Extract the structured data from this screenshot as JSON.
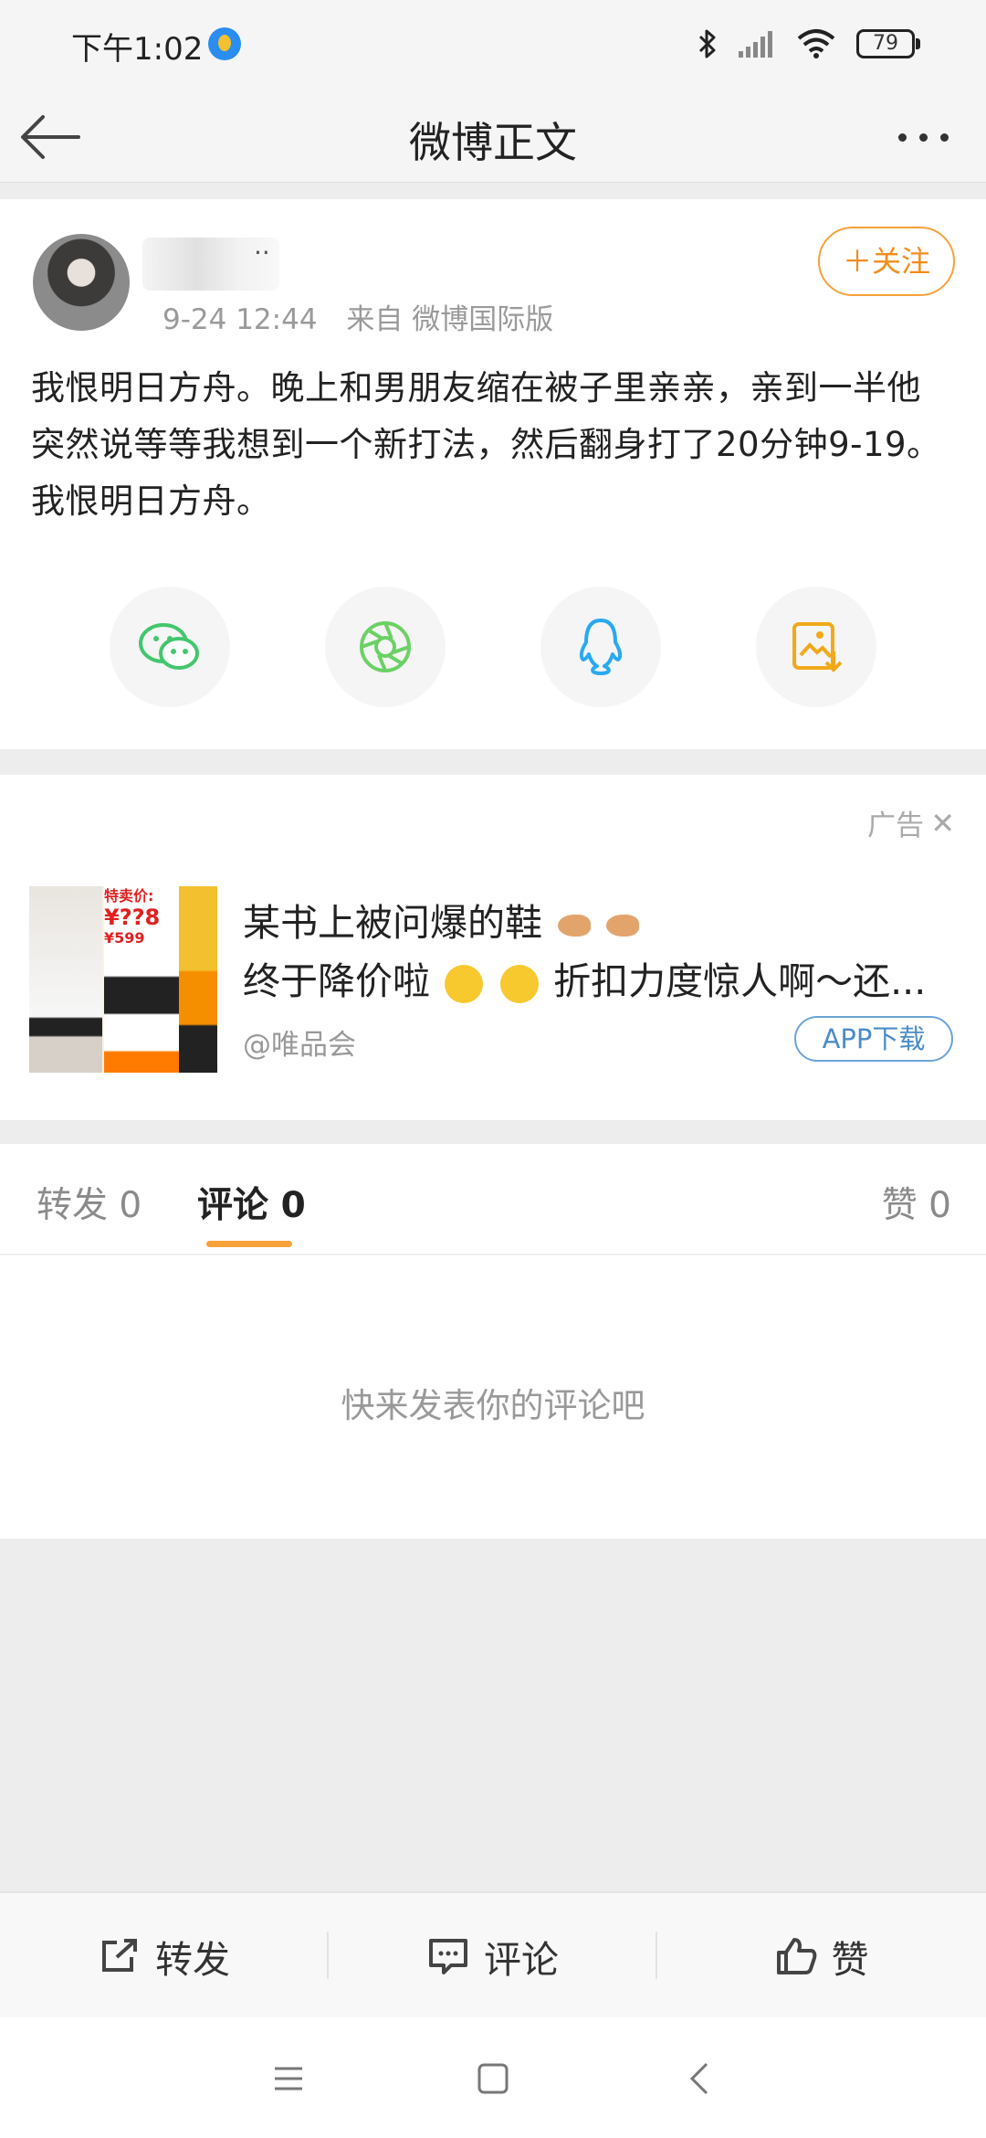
{
  "status_bar": {
    "time": "下午1:02",
    "battery": "79",
    "icons": [
      "app-notification-icon",
      "bluetooth-icon",
      "signal-icon",
      "wifi-icon",
      "battery-icon"
    ]
  },
  "header": {
    "title": "微博正文",
    "back_icon": "back-arrow-icon",
    "more_icon": "more-dots-icon"
  },
  "post": {
    "username_suffix": "··",
    "timestamp": "9-24 12:44",
    "source": "来自 微博国际版",
    "follow_label": "＋关注",
    "text": "我恨明日方舟。晚上和男朋友缩在被子里亲亲，亲到一半他突然说等等我想到一个新打法，然后翻身打了20分钟9-19。我恨明日方舟。",
    "share_targets": [
      "wechat-icon",
      "moments-icon",
      "qq-icon",
      "save-image-icon"
    ]
  },
  "ad": {
    "label": "广告",
    "close_icon": "close-icon",
    "image_price_label": "特卖价:",
    "image_price": "¥??8",
    "image_original_price": "¥599",
    "line1": "某书上被问爆的鞋",
    "line2": "终于降价啦",
    "line2_tail": "折扣力度惊人啊～还...",
    "source": "@唯品会",
    "download_label": "APP下载"
  },
  "tabs": {
    "repost": "转发 0",
    "comments": "评论 0",
    "likes": "赞 0"
  },
  "comments": {
    "empty_text": "快来发表你的评论吧"
  },
  "action_bar": {
    "repost": "转发",
    "comment": "评论",
    "like": "赞"
  },
  "system_nav": [
    "menu-icon",
    "home-icon",
    "back-icon"
  ],
  "colors": {
    "accent": "#f7a13a",
    "follow_text": "#f28d1b",
    "link_blue": "#4b8cc8",
    "wechat": "#43c66d",
    "moments": "#6bd164",
    "qq": "#29a9f1",
    "save": "#f1a91a"
  }
}
